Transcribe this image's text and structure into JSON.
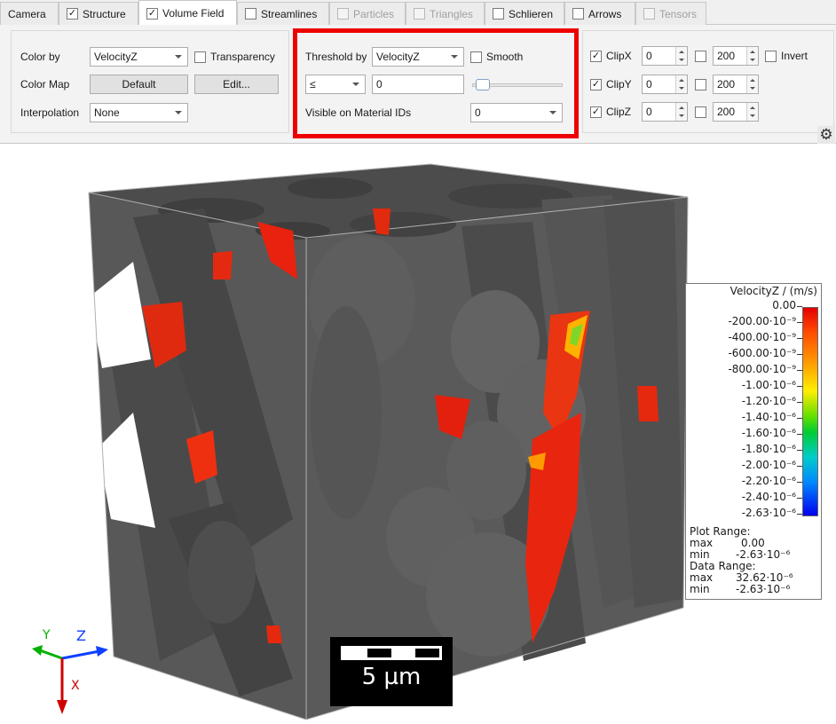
{
  "tabs": [
    {
      "label": "Camera",
      "checkbox": false,
      "checked": false,
      "state": "normal"
    },
    {
      "label": "Structure",
      "checkbox": true,
      "checked": true,
      "state": "normal"
    },
    {
      "label": "Volume Field",
      "checkbox": true,
      "checked": true,
      "state": "active"
    },
    {
      "label": "Streamlines",
      "checkbox": true,
      "checked": false,
      "state": "normal"
    },
    {
      "label": "Particles",
      "checkbox": true,
      "checked": false,
      "state": "disabled"
    },
    {
      "label": "Triangles",
      "checkbox": true,
      "checked": false,
      "state": "disabled"
    },
    {
      "label": "Schlieren",
      "checkbox": true,
      "checked": false,
      "state": "normal"
    },
    {
      "label": "Arrows",
      "checkbox": true,
      "checked": false,
      "state": "normal"
    },
    {
      "label": "Tensors",
      "checkbox": true,
      "checked": false,
      "state": "disabled"
    }
  ],
  "color_group": {
    "color_by_label": "Color by",
    "color_by_value": "VelocityZ",
    "transparency_label": "Transparency",
    "transparency_checked": false,
    "color_map_label": "Color Map",
    "color_map_value": "Default",
    "edit_label": "Edit...",
    "interpolation_label": "Interpolation",
    "interpolation_value": "None"
  },
  "threshold_group": {
    "threshold_by_label": "Threshold by",
    "threshold_by_value": "VelocityZ",
    "smooth_label": "Smooth",
    "smooth_checked": false,
    "operator_value": "≤",
    "threshold_value": "0",
    "slider_fraction": 0.05,
    "material_ids_label": "Visible on Material IDs",
    "material_ids_value": "0"
  },
  "clip_group": {
    "rows": [
      {
        "label": "ClipX",
        "checked": true,
        "min": "0",
        "max_checked": false,
        "max": "200"
      },
      {
        "label": "ClipY",
        "checked": true,
        "min": "0",
        "max_checked": false,
        "max": "200"
      },
      {
        "label": "ClipZ",
        "checked": true,
        "min": "0",
        "max_checked": false,
        "max": "200"
      }
    ],
    "invert_label": "Invert",
    "invert_checked": false
  },
  "settings_icon": "gear-icon",
  "highlight_color": "#ee0000",
  "legend": {
    "title": "VelocityZ / (m/s)",
    "ticks": [
      "0.00",
      "-200.00·10⁻⁹",
      "-400.00·10⁻⁹",
      "-600.00·10⁻⁹",
      "-800.00·10⁻⁹",
      "-1.00·10⁻⁶",
      "-1.20·10⁻⁶",
      "-1.40·10⁻⁶",
      "-1.60·10⁻⁶",
      "-1.80·10⁻⁶",
      "-2.00·10⁻⁶",
      "-2.20·10⁻⁶",
      "-2.40·10⁻⁶",
      "-2.63·10⁻⁶"
    ],
    "plot_range_label": "Plot Range:",
    "plot_max_label": "max",
    "plot_max": "0.00",
    "plot_min_label": "min",
    "plot_min": "-2.63·10⁻⁶",
    "data_range_label": "Data Range:",
    "data_max_label": "max",
    "data_max": "32.62·10⁻⁶",
    "data_min_label": "min",
    "data_min": "-2.63·10⁻⁶"
  },
  "scale_bar": {
    "label": "5 µm"
  },
  "axes": {
    "x": "X",
    "y": "Y",
    "z": "Z"
  }
}
